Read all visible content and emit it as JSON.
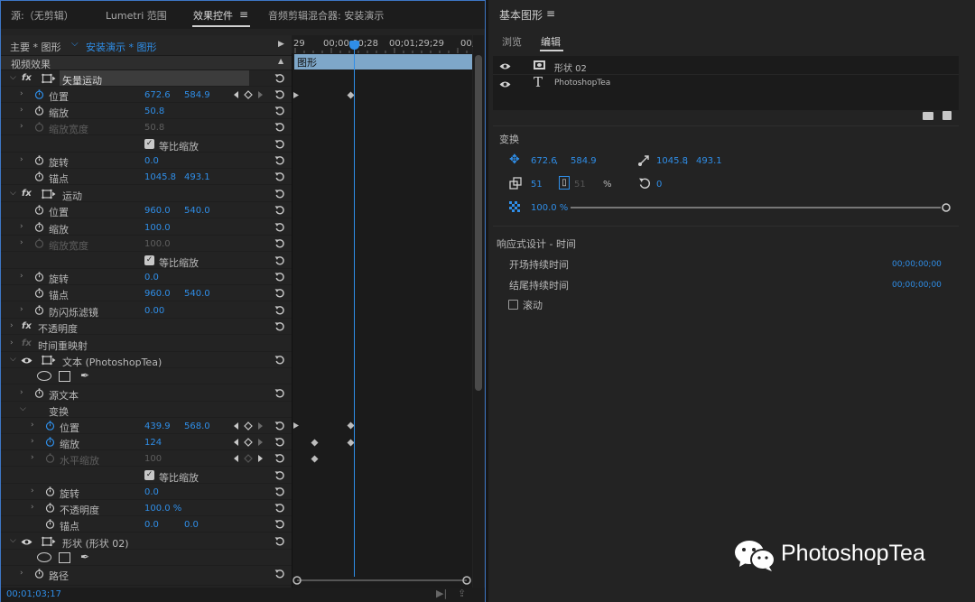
{
  "effect_controls_panel": {
    "tabs": [
      {
        "label": "源:（无剪辑）",
        "active": false
      },
      {
        "label": "Lumetri 范围",
        "active": false
      },
      {
        "label": "效果控件",
        "active": true
      },
      {
        "label": "音频剪辑混合器: 安装演示",
        "active": false
      }
    ],
    "tab_menu_icon": "hamburger-menu-icon",
    "master_label": "主要 * 图形",
    "sequence_label": "安装演示 * 图形",
    "video_effects_label": "视频效果",
    "timeline": {
      "ruler": [
        "29",
        "00;00;00;28",
        "00;01;29;29",
        "00;"
      ],
      "clip_label": "图形"
    },
    "rows": {
      "vector_motion": "矢量运动",
      "vm_position": {
        "label": "位置",
        "x": "672.6",
        "y": "584.9"
      },
      "vm_scale": {
        "label": "缩放",
        "value": "50.8"
      },
      "vm_scale_width": {
        "label": "缩放宽度",
        "value": "50.8"
      },
      "vm_uniform": "等比缩放",
      "vm_rotation": {
        "label": "旋转",
        "value": "0.0"
      },
      "vm_anchor": {
        "label": "锚点",
        "x": "1045.8",
        "y": "493.1"
      },
      "motion": "运动",
      "m_position": {
        "label": "位置",
        "x": "960.0",
        "y": "540.0"
      },
      "m_scale": {
        "label": "缩放",
        "value": "100.0"
      },
      "m_scale_width": {
        "label": "缩放宽度",
        "value": "100.0"
      },
      "m_uniform": "等比缩放",
      "m_rotation": {
        "label": "旋转",
        "value": "0.0"
      },
      "m_anchor": {
        "label": "锚点",
        "x": "960.0",
        "y": "540.0"
      },
      "m_antiflicker": {
        "label": "防闪烁滤镜",
        "value": "0.00"
      },
      "opacity": "不透明度",
      "time_remap": "时间重映射",
      "text_layer": "文本 (PhotoshopTea)",
      "source_text": "源文本",
      "transform": "变换",
      "t_position": {
        "label": "位置",
        "x": "439.9",
        "y": "568.0"
      },
      "t_scale": {
        "label": "缩放",
        "value": "124"
      },
      "t_hscale": {
        "label": "水平缩放",
        "value": "100"
      },
      "t_uniform": "等比缩放",
      "t_rotation": {
        "label": "旋转",
        "value": "0.0"
      },
      "t_opacity": {
        "label": "不透明度",
        "value": "100.0 %"
      },
      "t_anchor": {
        "label": "锚点",
        "x": "0.0",
        "y": "0.0"
      },
      "shape_layer": "形状 (形状 02)",
      "path": "路径"
    },
    "status_time": "00;01;03;17"
  },
  "essential_graphics_panel": {
    "title": "基本图形",
    "menu_icon": "hamburger-menu-icon",
    "tabs": [
      {
        "label": "浏览",
        "active": false
      },
      {
        "label": "编辑",
        "active": true
      }
    ],
    "layers": [
      {
        "name": "形状 02",
        "icon": "shape-layer-icon",
        "visible": true
      },
      {
        "name": "PhotoshopTea",
        "icon": "text-layer-icon",
        "visible": true
      }
    ],
    "transform": {
      "section_label": "变换",
      "position_x": "672.6",
      "position_sep": ",",
      "position_y": "584.9",
      "anchor_x": "1045.8",
      "anchor_sep": ",",
      "anchor_y": "493.1",
      "scale": "51",
      "scale_height": "51",
      "scale_unit": "%",
      "rotation": "0",
      "opacity": "100.0 %",
      "opacity_fraction": 1.0
    },
    "responsive": {
      "section_label": "响应式设计 - 时间",
      "intro_label": "开场持续时间",
      "intro_value": "00;00;00;00",
      "outro_label": "结尾持续时间",
      "outro_value": "00;00;00;00",
      "roll_label": "滚动",
      "roll_checked": false
    }
  },
  "watermark": {
    "text": "PhotoshopTea",
    "logo": "wechat-logo"
  },
  "colors": {
    "accent_blue": "#2f8ee8",
    "panel_bg": "#232323",
    "clip_bar": "#7ea7c9",
    "focus_border": "#3d76c5"
  }
}
